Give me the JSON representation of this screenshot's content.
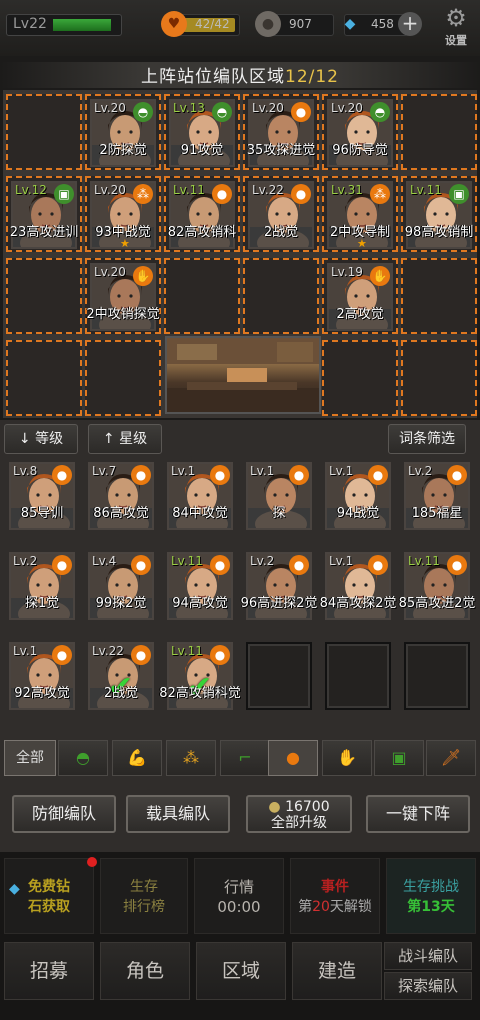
{
  "topbar": {
    "level": "Lv22",
    "stamina": "42/42",
    "coins": "907",
    "diamonds": "458",
    "settings_label": "设置"
  },
  "formation": {
    "title": "上阵站位编队区域",
    "count": "12/12",
    "heroes": [
      {
        "level": "Lv.20",
        "name": "2防探觉",
        "badge": "helmet",
        "color": "#3f8f2c"
      },
      {
        "level": "Lv.13",
        "name": "91攻觉",
        "badge": "helmet",
        "color": "#3f8f2c"
      },
      {
        "level": "Lv.20",
        "name": "35攻探进觉",
        "badge": "grenade",
        "color": "#e9790f"
      },
      {
        "level": "Lv.20",
        "name": "96防导觉",
        "badge": "helmet",
        "color": "#3f8f2c"
      },
      {
        "level": "Lv.12",
        "name": "23高攻进训",
        "badge": "fuel",
        "color": "#3f8f2c"
      },
      {
        "level": "Lv.20",
        "name": "93中战觉",
        "badge": "ammo",
        "color": "#e9790f"
      },
      {
        "level": "Lv.11",
        "name": "82高攻销科",
        "badge": "grenade",
        "color": "#e9790f"
      },
      {
        "level": "Lv.22",
        "name": "2战觉",
        "badge": "grenade",
        "color": "#e9790f"
      },
      {
        "level": "Lv.31",
        "name": "2中攻导制",
        "badge": "ammo",
        "color": "#e9790f"
      },
      {
        "level": "Lv.11",
        "name": "98高攻销制",
        "badge": "fuel",
        "color": "#3f8f2c"
      },
      {
        "level": "Lv.20",
        "name": "2中攻销探觉",
        "badge": "glove",
        "color": "#e9790f"
      },
      {
        "level": "Lv.19",
        "name": "2高攻觉",
        "badge": "glove",
        "color": "#e9790f"
      }
    ]
  },
  "filters": {
    "level_sort": "等级",
    "star_sort": "星级",
    "trait_filter": "词条筛选"
  },
  "roster": [
    {
      "level": "Lv.8",
      "name": "85导训"
    },
    {
      "level": "Lv.7",
      "name": "86高攻觉"
    },
    {
      "level": "Lv.1",
      "name": "84中攻觉"
    },
    {
      "level": "Lv.1",
      "name": "探"
    },
    {
      "level": "Lv.1",
      "name": "94战觉"
    },
    {
      "level": "Lv.2",
      "name": "185福星"
    },
    {
      "level": "Lv.2",
      "name": "探1觉"
    },
    {
      "level": "Lv.4",
      "name": "99探2觉"
    },
    {
      "level": "Lv.11",
      "name": "94高攻觉"
    },
    {
      "level": "Lv.2",
      "name": "96高进探2觉"
    },
    {
      "level": "Lv.1",
      "name": "84高攻探2觉"
    },
    {
      "level": "Lv.11",
      "name": "85高攻进2觉"
    },
    {
      "level": "Lv.1",
      "name": "92高攻觉"
    },
    {
      "level": "Lv.22",
      "name": "2战觉"
    },
    {
      "level": "Lv.11",
      "name": "82高攻销科觉"
    }
  ],
  "categories": {
    "all": "全部"
  },
  "actions": {
    "defense_team": "防御编队",
    "vehicle_team": "载具编队",
    "upgrade_cost": "16700",
    "upgrade_all": "全部升级",
    "one_click_remove": "一键下阵"
  },
  "menu": {
    "free_diamonds_line1": "免费钻",
    "free_diamonds_line2": "石获取",
    "rank_line1": "生存",
    "rank_line2": "排行榜",
    "market_line1": "行情",
    "market_line2": "00:00",
    "event_line1": "事件",
    "event_line2_pre": "第",
    "event_line2_num": "20",
    "event_line2_post": "天解锁",
    "challenge_line1": "生存挑战",
    "challenge_line2": "第13天",
    "recruit": "招募",
    "character": "角色",
    "area": "区域",
    "build": "建造",
    "battle_team": "战斗编队",
    "explore_team": "探索编队"
  }
}
